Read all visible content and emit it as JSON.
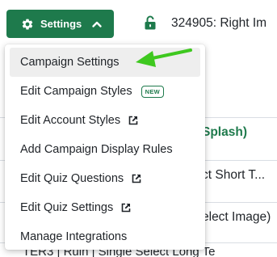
{
  "toolbar": {
    "settings_label": "Settings",
    "campaign_title": "324905: Right Im"
  },
  "background_rows": [
    {
      "text": "Splash)"
    },
    {
      "text": "ct Short T..."
    },
    {
      "text": "elect Image)"
    },
    {
      "text": "TER3 | Ruin | Single Select Long Te"
    }
  ],
  "menu": {
    "items": [
      {
        "label": "Campaign Settings"
      },
      {
        "label": "Edit Campaign Styles",
        "badge": "NEW"
      },
      {
        "label": "Edit Account Styles"
      },
      {
        "label": "Add Campaign Display Rules"
      },
      {
        "label": "Edit Quiz Questions"
      },
      {
        "label": "Edit Quiz Settings"
      },
      {
        "label": "Manage Integrations"
      }
    ]
  },
  "colors": {
    "brand_green": "#1e7a4c",
    "arrow_green": "#3ec81f",
    "active_bg": "#eeeeee"
  },
  "icons": [
    "gear-icon",
    "chevron-up-icon",
    "unlocked-icon",
    "external-link-icon",
    "arrow-pointer-icon"
  ]
}
